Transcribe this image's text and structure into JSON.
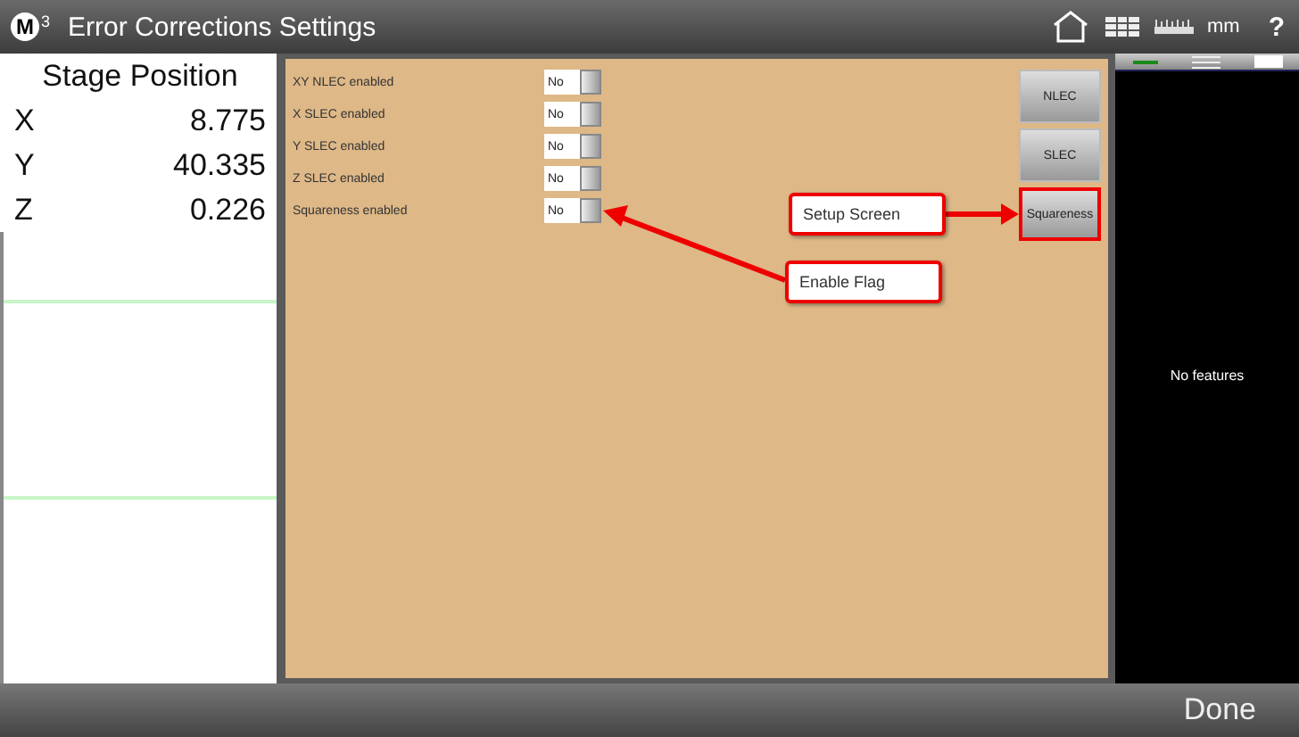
{
  "window": {
    "logo": "M",
    "logo_sup": "3",
    "title": "Error Corrections Settings",
    "units": "mm",
    "help": "?"
  },
  "position": {
    "title": "Stage Position",
    "axes": [
      {
        "axis": "X",
        "value": "8.775"
      },
      {
        "axis": "Y",
        "value": "40.335"
      },
      {
        "axis": "Z",
        "value": "0.226"
      }
    ]
  },
  "settings": [
    {
      "label": "XY NLEC enabled",
      "value": "No",
      "on": false
    },
    {
      "label": "X SLEC enabled",
      "value": "No",
      "on": false
    },
    {
      "label": "Y SLEC enabled",
      "value": "No",
      "on": false
    },
    {
      "label": "Z SLEC enabled",
      "value": "No",
      "on": false
    },
    {
      "label": "Squareness enabled",
      "value": "No",
      "on": false
    }
  ],
  "setup_buttons": [
    {
      "label": "NLEC",
      "highlighted": false
    },
    {
      "label": "SLEC",
      "highlighted": false
    },
    {
      "label": "Squareness",
      "highlighted": true
    }
  ],
  "callouts": [
    {
      "kind": "setup",
      "text": "Setup Screen"
    },
    {
      "kind": "flag",
      "text": "Enable Flag"
    }
  ],
  "features": {
    "empty_text": "No features"
  },
  "footer": {
    "done": "Done"
  }
}
